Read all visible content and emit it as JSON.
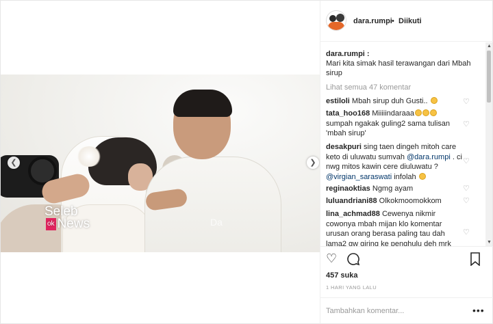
{
  "post": {
    "username": "dara.rumpi",
    "separator": "•",
    "follow_status": "Diikuti"
  },
  "media": {
    "logo_line1": "Seleb",
    "logo_badge": "ok",
    "logo_line2": "News",
    "watermark": "Da",
    "prev_icon": "chevron-left-icon",
    "next_icon": "chevron-right-icon"
  },
  "caption": {
    "user": "dara.rumpi :",
    "text": "Mari kita simak hasil terawangan dari Mbah sirup"
  },
  "view_all": "Lihat semua 47 komentar",
  "comments": [
    {
      "user": "estiloli",
      "text": "Mbah sirup duh Gusti..",
      "emoji_count": 1
    },
    {
      "user": "tata_hoo168",
      "text": "Miiiiindaraaa",
      "text2": "sumpah ngakak guling2 sama tulisan 'mbah sirup'",
      "emoji_count": 3
    },
    {
      "user": "desakpuri",
      "text": "sing taen dingeh mitoh care keto di uluwatu sumvah",
      "mention1": "@dara.rumpi",
      "text_mid": ". ci nwg mitos kawin cere diuluwatu ?",
      "mention2": "@virgian_saraswati",
      "text_end": "infolah",
      "emoji_count": 1
    },
    {
      "user": "reginaoktias",
      "text": "Ngmg ayam"
    },
    {
      "user": "luluandriani88",
      "text": "Olkokmoomokkom"
    },
    {
      "user": "lina_achmad88",
      "text": "Cewenya nikmir cowonya mbah mijan klo komentar urusan orang berasa paling tau dah lama2 gw giring ke penghulu deh mrk"
    }
  ],
  "actions": {
    "like_icon": "heart-icon",
    "comment_icon": "comment-icon",
    "save_icon": "bookmark-icon",
    "likes": "457 suka",
    "time": "1 HARI YANG LALU"
  },
  "add_comment": {
    "placeholder": "Tambahkan komentar...",
    "more": "•••"
  },
  "colors": {
    "text": "#262626",
    "muted": "#999999",
    "mention": "#003569",
    "border": "#efefef"
  }
}
